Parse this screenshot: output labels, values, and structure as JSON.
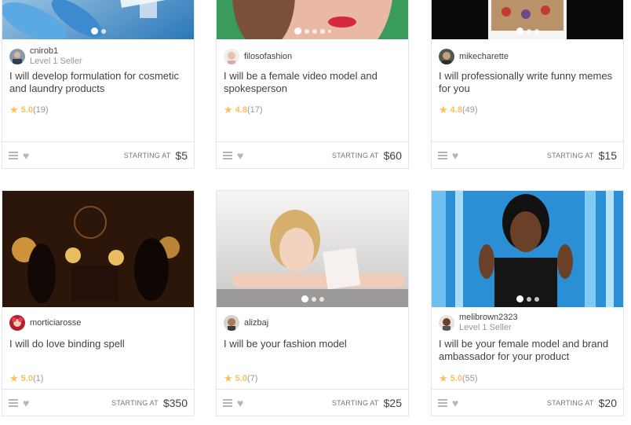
{
  "cards": [
    {
      "seller_name": "cnirob1",
      "seller_level": "Level 1 Seller",
      "title": "I will develop formulation for cosmetic and laundry products",
      "rating": "5.0",
      "reviews": "(19)",
      "starting_label": "STARTING AT",
      "price": "$5",
      "dots": 2,
      "active_dot": 0
    },
    {
      "seller_name": "filosofashion",
      "seller_level": "",
      "title": "I will be a female video model and spokesperson",
      "rating": "4.8",
      "reviews": "(17)",
      "starting_label": "STARTING AT",
      "price": "$60",
      "dots": 5,
      "active_dot": 0
    },
    {
      "seller_name": "mikecharette",
      "seller_level": "",
      "title": "I will professionally write funny memes for you",
      "rating": "4.8",
      "reviews": "(49)",
      "starting_label": "STARTING AT",
      "price": "$15",
      "dots": 3,
      "active_dot": 0
    },
    {
      "seller_name": "morticiarosse",
      "seller_level": "",
      "title": "I will do love binding spell",
      "rating": "5.0",
      "reviews": "(1)",
      "starting_label": "STARTING AT",
      "price": "$350",
      "dots": 0,
      "active_dot": 0
    },
    {
      "seller_name": "alizbaj",
      "seller_level": "",
      "title": "I will be your fashion model",
      "rating": "5.0",
      "reviews": "(7)",
      "starting_label": "STARTING AT",
      "price": "$25",
      "dots": 3,
      "active_dot": 0
    },
    {
      "seller_name": "melibrown2323",
      "seller_level": "Level 1 Seller",
      "title": "I will be your female model and brand ambassador for your product",
      "rating": "5.0",
      "reviews": "(55)",
      "starting_label": "STARTING AT",
      "price": "$20",
      "dots": 3,
      "active_dot": 0
    }
  ],
  "colors": {
    "star": "#ffbe5b",
    "border": "#e4e5e7",
    "text": "#404145",
    "muted": "#95979d"
  },
  "icons": {
    "menu": "list-icon",
    "favorite": "heart-icon",
    "rating": "star-icon"
  }
}
